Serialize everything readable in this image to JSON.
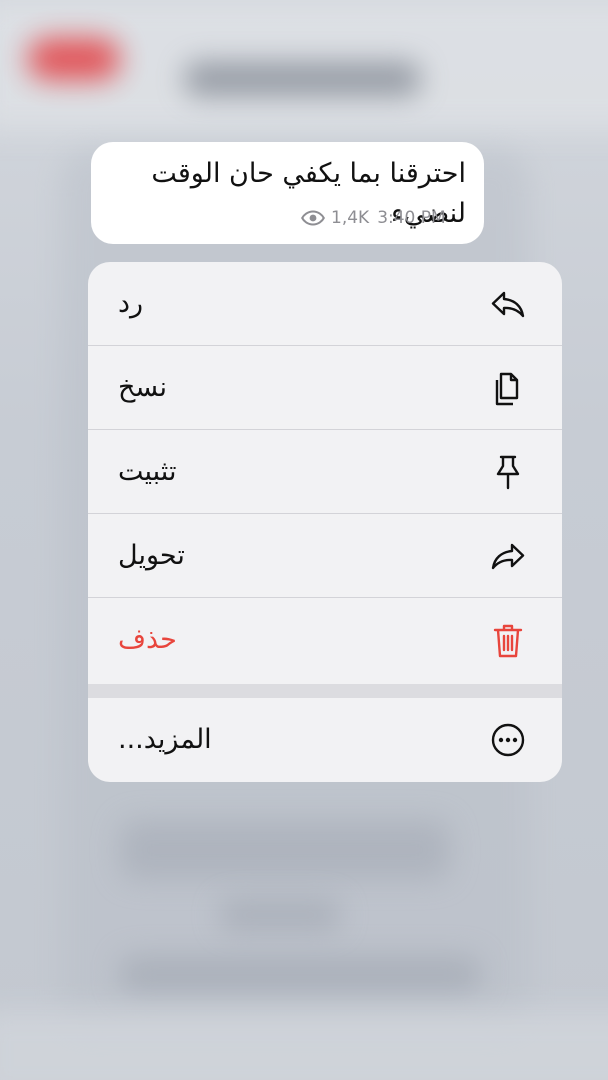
{
  "message": {
    "text": "احترقنا بما يكفي حان الوقت لنضيء",
    "views": "1,4K",
    "time": "3:40 PM"
  },
  "menu": {
    "items": [
      {
        "label": "رد",
        "icon": "reply-icon"
      },
      {
        "label": "نسخ",
        "icon": "copy-icon"
      },
      {
        "label": "تثبيت",
        "icon": "pin-icon"
      },
      {
        "label": "تحويل",
        "icon": "forward-icon"
      },
      {
        "label": "حذف",
        "icon": "trash-icon",
        "color": "#e8453c"
      }
    ],
    "more": {
      "label": "المزيد...",
      "icon": "more-icon"
    }
  }
}
